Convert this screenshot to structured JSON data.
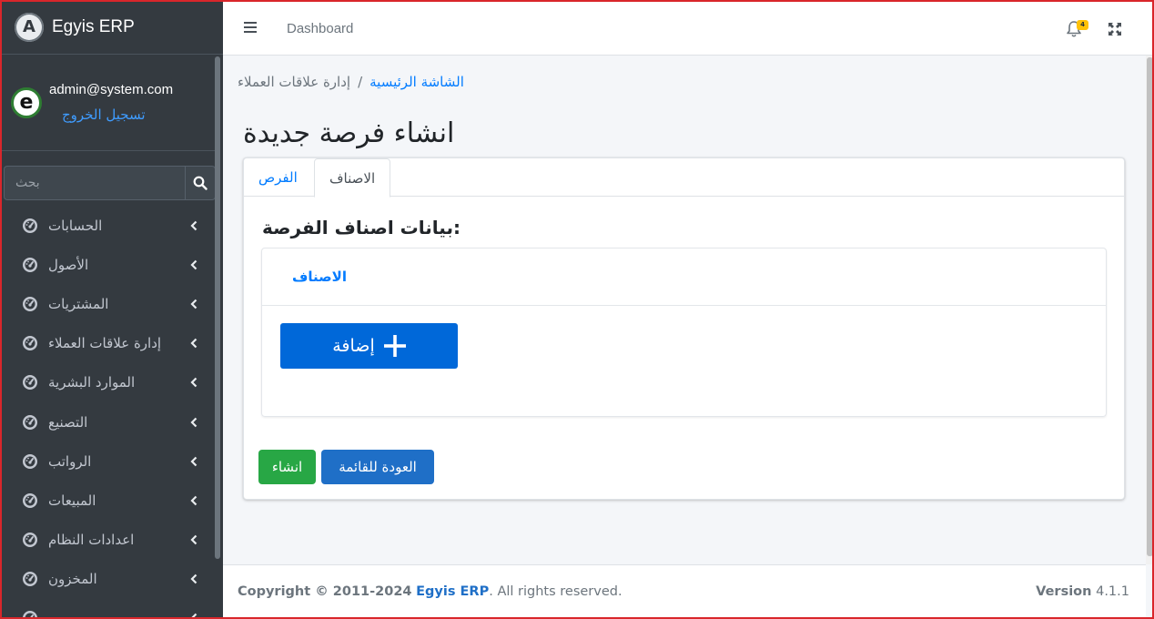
{
  "brand": {
    "logo_letter": "A",
    "name": "Egyis ERP"
  },
  "user": {
    "avatar_letter": "e",
    "email": "admin@system.com",
    "logout": "تسجيل الخروج"
  },
  "search": {
    "placeholder": "بحث"
  },
  "sidebar": {
    "items": [
      {
        "label": "الحسابات",
        "icon": "tachometer-icon"
      },
      {
        "label": "الأصول",
        "icon": "tachometer-icon"
      },
      {
        "label": "المشتريات",
        "icon": "tachometer-icon"
      },
      {
        "label": "إدارة علاقات العملاء",
        "icon": "tachometer-icon"
      },
      {
        "label": "الموارد البشرية",
        "icon": "tachometer-icon"
      },
      {
        "label": "التصنيع",
        "icon": "tachometer-icon"
      },
      {
        "label": "الرواتب",
        "icon": "tachometer-icon"
      },
      {
        "label": "المبيعات",
        "icon": "tachometer-icon"
      },
      {
        "label": "اعدادات النظام",
        "icon": "tachometer-icon"
      },
      {
        "label": "المخزون",
        "icon": "tachometer-icon"
      }
    ]
  },
  "topbar": {
    "link": "Dashboard",
    "notification_count": "4"
  },
  "breadcrumb": {
    "home": "الشاشة الرئيسية",
    "separator": "/",
    "current": "إدارة علاقات العملاء"
  },
  "page": {
    "title": "انشاء فرصة جديدة"
  },
  "tabs": {
    "opportunities": "الفرص",
    "categories": "الاصناف"
  },
  "form": {
    "section_title": "بيانات اصناف الفرصة:",
    "inner_tab": "الاصناف",
    "add_button": "إضافة",
    "create_button": "انشاء",
    "back_button": "العودة للقائمة"
  },
  "footer": {
    "copyright": "Copyright © 2011-2024",
    "brand": "Egyis ERP",
    "rights": ". All rights reserved.",
    "version_label": "Version",
    "version": "4.1.1"
  },
  "colors": {
    "accent": "#007bff",
    "success": "#28a745",
    "sidebar": "#343a40",
    "badge": "#ffc107"
  }
}
